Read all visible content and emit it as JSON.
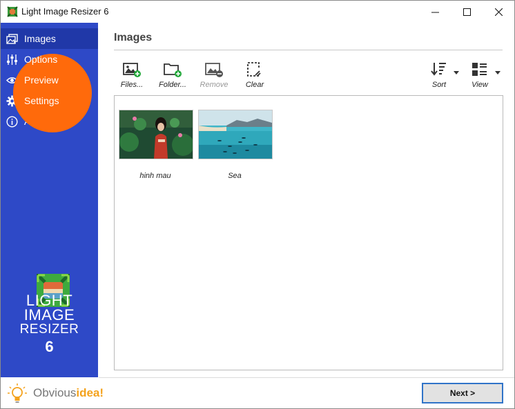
{
  "window": {
    "title": "Light Image Resizer 6"
  },
  "sidebar": {
    "items": [
      {
        "label": "Images",
        "icon": "images-icon",
        "active": true
      },
      {
        "label": "Options",
        "icon": "sliders-icon",
        "active": false
      },
      {
        "label": "Preview",
        "icon": "eye-icon",
        "active": false
      },
      {
        "label": "Settings",
        "icon": "gear-icon",
        "active": false
      },
      {
        "label": "About",
        "icon": "info-icon",
        "active": false
      }
    ],
    "logo": {
      "line1": "LIGHT",
      "line2": "IMAGE",
      "line3": "RESIZER",
      "number": "6"
    },
    "brand": {
      "part1": "Obvious",
      "part2": "idea!"
    }
  },
  "main": {
    "heading": "Images",
    "toolbar": {
      "files": "Files...",
      "folder": "Folder...",
      "remove": "Remove",
      "clear": "Clear",
      "sort": "Sort",
      "view": "View"
    },
    "images": [
      {
        "caption": "hinh mau"
      },
      {
        "caption": "Sea"
      }
    ]
  },
  "footer": {
    "next": "Next >"
  },
  "colors": {
    "sidebar": "#2e49c7",
    "sidebar_active": "#2038a8",
    "highlight": "#ff6a0b",
    "brand_accent": "#f4a21c",
    "button_border": "#2f73c8"
  }
}
